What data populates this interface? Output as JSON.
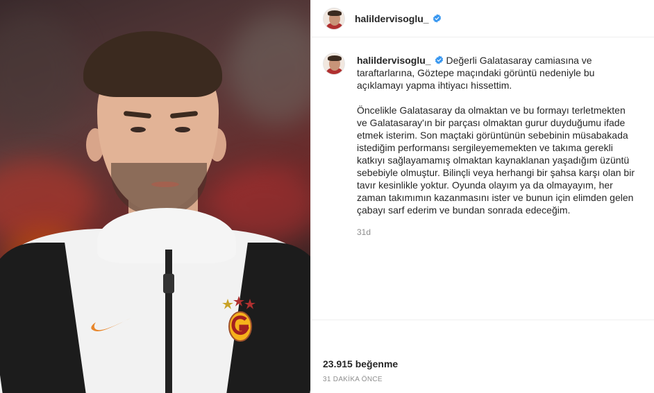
{
  "post": {
    "username": "halildervisoglu_",
    "verified": true,
    "caption_paragraphs": [
      "Değerli Galatasaray camiasına ve taraftarlarına, Göztepe maçındaki görüntü nedeniyle bu açıklamayı yapma ihtiyacı hissettim.",
      "Öncelikle Galatasaray da olmaktan ve bu formayı terletmekten ve Galatasaray'ın bir parçası olmaktan gurur duyduğumu ifade etmek isterim. Son maçtaki görüntünün sebebinin müsabakada istediğim performansı sergileyememekten ve takıma gerekli katkıyı sağlayamamış olmaktan kaynaklanan yaşadığım üzüntü sebebiyle olmuştur. Bilinçli veya herhangi bir şahsa karşı olan bir tavır kesinlikle yoktur. Oyunda olayım ya da olmayayım, her zaman takımımın kazanmasını ister ve bunun için elimden gelen çabayı sarf ederim ve bundan sonrada edeceğim."
    ],
    "caption_age": "31d",
    "likes_text": "23.915 beğenme",
    "posted_time": "31 DAKİKA ÖNCE"
  },
  "icons": {
    "verified": "verified-badge-icon",
    "avatar": "profile-avatar"
  },
  "colors": {
    "verified_blue": "#3897f0",
    "text_primary": "#262626",
    "text_secondary": "#8e8e8e",
    "divider": "#efefef"
  }
}
